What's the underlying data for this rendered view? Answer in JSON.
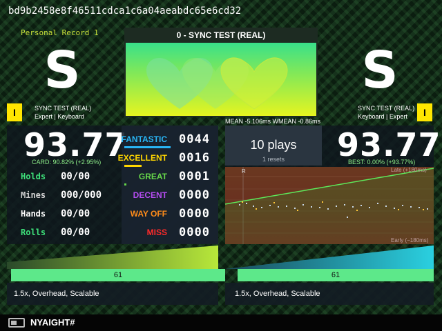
{
  "header": {
    "hash": "bd9b2458e8f46511cdca1c6a04aeabdc65e6cd32"
  },
  "personal_record": "Personal Record 1",
  "song": {
    "title": "0 - SYNC TEST (REAL)",
    "mean_text": "MEAN -5.106ms WMEAN -0.86ms"
  },
  "left": {
    "grade": "S",
    "difficulty_badge": "I",
    "song_name": "SYNC TEST (REAL)",
    "chart_info": "Expert | Keyboard",
    "score": "93.77",
    "card_text": "CARD: 90.82% (+2.95%)",
    "stats": [
      {
        "label": "Holds",
        "value": "00/00",
        "color": "#3ee07a"
      },
      {
        "label": "Mines",
        "value": "000/000",
        "color": "#cfcfcf"
      },
      {
        "label": "Hands",
        "value": "00/00",
        "color": "#ffffff"
      },
      {
        "label": "Rolls",
        "value": "00/00",
        "color": "#3ee07a"
      }
    ],
    "combo": "61",
    "mods": "1.5x, Overhead, Scalable"
  },
  "judgments": [
    {
      "label": "FANTASTIC",
      "count": "0044",
      "color": "#29b6f6",
      "bar_fraction": 0.73
    },
    {
      "label": "EXCELLENT",
      "count": "0016",
      "color": "#ffd600",
      "bar_fraction": 0.27
    },
    {
      "label": "GREAT",
      "count": "0001",
      "color": "#66d64a",
      "bar_fraction": 0.03
    },
    {
      "label": "DECENT",
      "count": "0000",
      "color": "#b44cf0",
      "bar_fraction": 0
    },
    {
      "label": "WAY OFF",
      "count": "0000",
      "color": "#ff8c1a",
      "bar_fraction": 0
    },
    {
      "label": "MISS",
      "count": "0000",
      "color": "#ff2a2a",
      "bar_fraction": 0
    }
  ],
  "right": {
    "grade": "S",
    "difficulty_badge": "I",
    "song_name": "SYNC TEST (REAL)",
    "chart_info": "Keyboard | Expert",
    "plays": "10 plays",
    "resets": "1 resets",
    "score": "93.77",
    "best_text": "BEST: 0.00% (+93.77%)",
    "graph_late_label": "Late (+180ms)",
    "graph_early_label": "Early (−180ms)",
    "graph_r_label": "R",
    "combo": "61",
    "mods": "1.5x, Overhead, Scalable"
  },
  "footer": {
    "profile_name": "NYAIGHT#"
  },
  "colors": {
    "accent_green": "#5de88a",
    "badge_yellow": "#ffe600"
  }
}
